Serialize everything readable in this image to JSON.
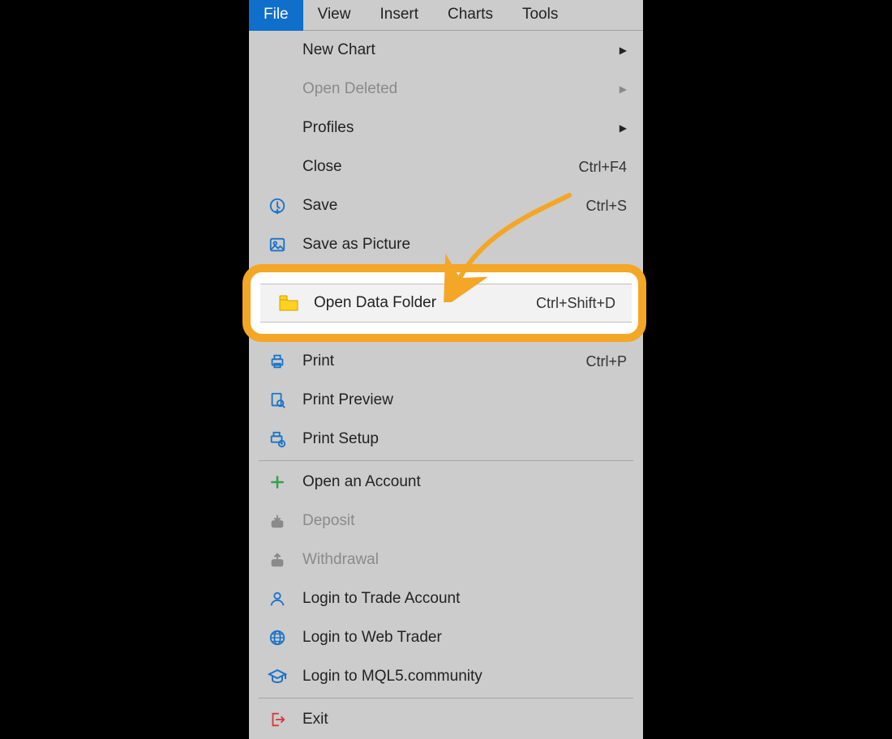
{
  "menubar": {
    "items": [
      "File",
      "View",
      "Insert",
      "Charts",
      "Tools"
    ],
    "active_index": 0
  },
  "menu": {
    "groups": [
      [
        {
          "id": "new-chart",
          "label": "New Chart",
          "icon": "",
          "submenu": true
        },
        {
          "id": "open-deleted",
          "label": "Open Deleted",
          "icon": "",
          "submenu": true,
          "disabled": true
        },
        {
          "id": "profiles",
          "label": "Profiles",
          "icon": "",
          "submenu": true
        },
        {
          "id": "close",
          "label": "Close",
          "icon": "",
          "shortcut": "Ctrl+F4"
        },
        {
          "id": "save",
          "label": "Save",
          "icon": "save-icon",
          "shortcut": "Ctrl+S"
        },
        {
          "id": "save-as-picture",
          "label": "Save as Picture",
          "icon": "picture-icon"
        }
      ],
      [
        {
          "id": "open-data-folder",
          "label": "Open Data Folder",
          "icon": "folder-icon",
          "shortcut": "Ctrl+Shift+D",
          "highlighted": true
        }
      ],
      [
        {
          "id": "print",
          "label": "Print",
          "icon": "print-icon",
          "shortcut": "Ctrl+P"
        },
        {
          "id": "print-preview",
          "label": "Print Preview",
          "icon": "print-preview-icon"
        },
        {
          "id": "print-setup",
          "label": "Print Setup",
          "icon": "print-setup-icon"
        }
      ],
      [
        {
          "id": "open-an-account",
          "label": "Open an Account",
          "icon": "plus-icon"
        },
        {
          "id": "deposit",
          "label": "Deposit",
          "icon": "deposit-icon",
          "disabled": true
        },
        {
          "id": "withdrawal",
          "label": "Withdrawal",
          "icon": "withdrawal-icon",
          "disabled": true
        },
        {
          "id": "login-trade-account",
          "label": "Login to Trade Account",
          "icon": "user-icon"
        },
        {
          "id": "login-web-trader",
          "label": "Login to Web Trader",
          "icon": "globe-icon"
        },
        {
          "id": "login-mql5",
          "label": "Login to MQL5.community",
          "icon": "graduate-icon"
        }
      ],
      [
        {
          "id": "exit",
          "label": "Exit",
          "icon": "exit-icon"
        }
      ]
    ]
  },
  "annotation": {
    "target": "open-data-folder",
    "color": "#f4a626"
  }
}
